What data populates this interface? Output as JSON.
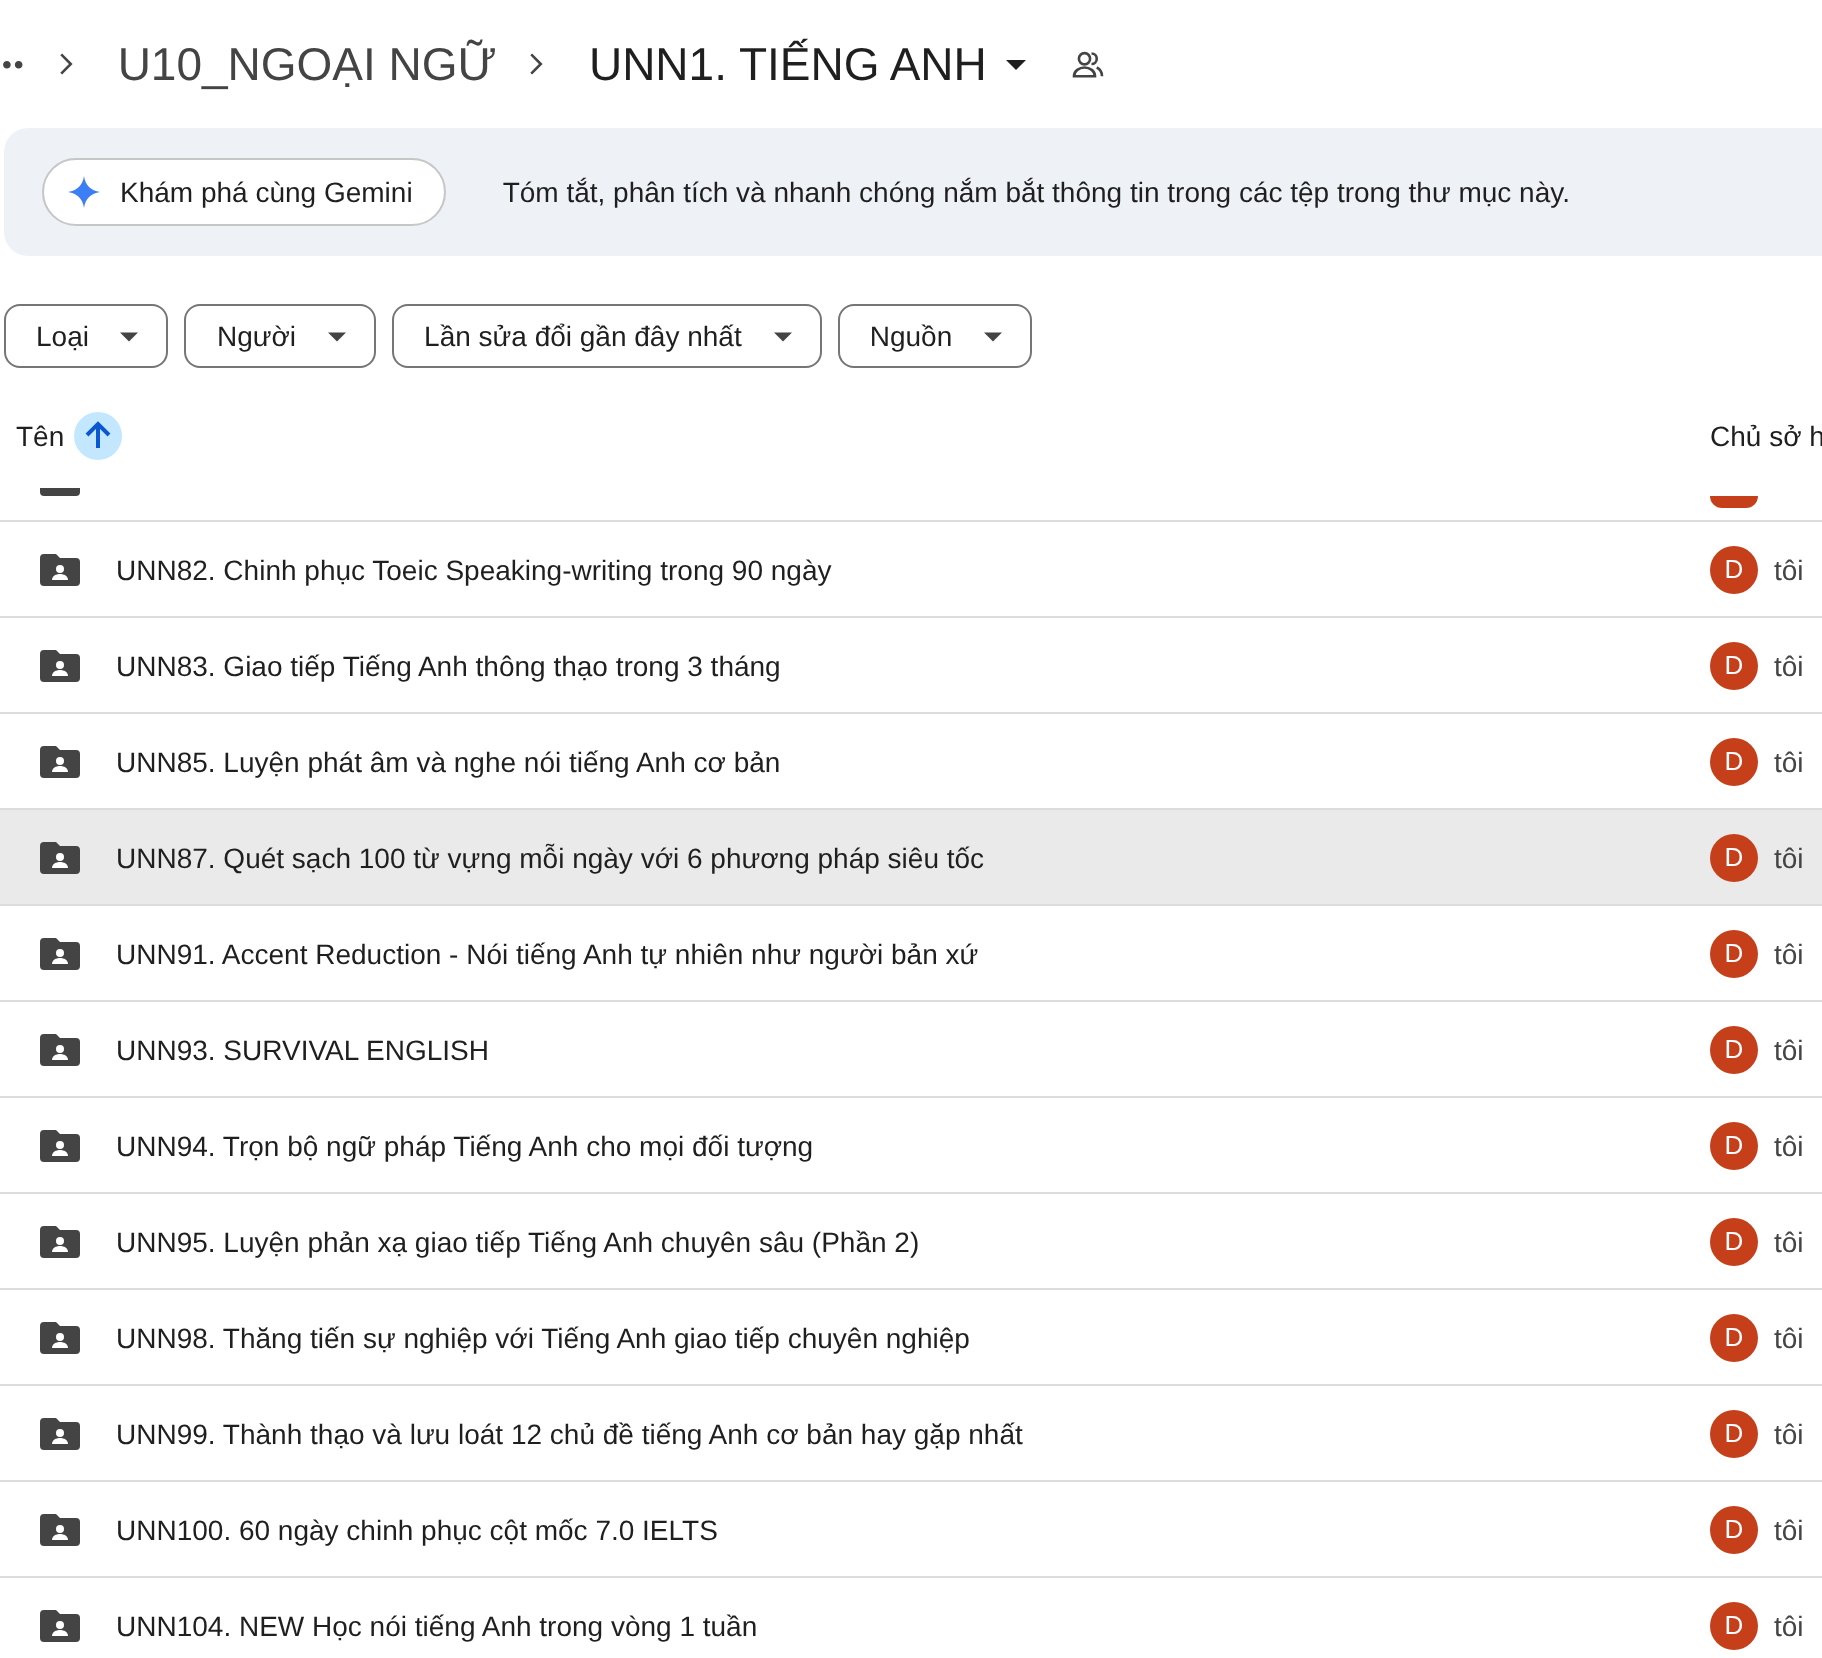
{
  "breadcrumb": {
    "more": "••",
    "parent": "U10_NGOẠI NGỮ",
    "current": "UNN1. TIẾNG ANH"
  },
  "gemini": {
    "button": "Khám phá cùng Gemini",
    "description": "Tóm tắt, phân tích và nhanh chóng nắm bắt thông tin trong các tệp trong thư mục này."
  },
  "filters": [
    "Loại",
    "Người",
    "Lần sửa đổi gần đây nhất",
    "Nguồn"
  ],
  "table": {
    "columns": [
      "Tên",
      "Chủ sở h"
    ],
    "rows": [
      {
        "name": "UNN82. Chinh phục Toeic Speaking-writing trong 90 ngày",
        "owner_initial": "D",
        "owner": "tôi",
        "selected": false
      },
      {
        "name": "UNN83. Giao tiếp Tiếng Anh thông thạo trong 3 tháng",
        "owner_initial": "D",
        "owner": "tôi",
        "selected": false
      },
      {
        "name": "UNN85. Luyện phát âm và nghe nói tiếng Anh cơ bản",
        "owner_initial": "D",
        "owner": "tôi",
        "selected": false
      },
      {
        "name": "UNN87. Quét sạch 100 từ vựng mỗi ngày với 6 phương pháp siêu tốc",
        "owner_initial": "D",
        "owner": "tôi",
        "selected": true
      },
      {
        "name": "UNN91. Accent Reduction - Nói tiếng Anh tự nhiên như người bản xứ",
        "owner_initial": "D",
        "owner": "tôi",
        "selected": false
      },
      {
        "name": "UNN93. SURVIVAL ENGLISH",
        "owner_initial": "D",
        "owner": "tôi",
        "selected": false
      },
      {
        "name": "UNN94. Trọn bộ ngữ pháp Tiếng Anh cho mọi đối tượng",
        "owner_initial": "D",
        "owner": "tôi",
        "selected": false
      },
      {
        "name": "UNN95. Luyện phản xạ giao tiếp Tiếng Anh chuyên sâu (Phần 2)",
        "owner_initial": "D",
        "owner": "tôi",
        "selected": false
      },
      {
        "name": "UNN98. Thăng tiến sự nghiệp với Tiếng Anh giao tiếp chuyên nghiệp",
        "owner_initial": "D",
        "owner": "tôi",
        "selected": false
      },
      {
        "name": "UNN99. Thành thạo và lưu loát 12 chủ đề tiếng Anh cơ bản hay gặp nhất",
        "owner_initial": "D",
        "owner": "tôi",
        "selected": false
      },
      {
        "name": "UNN100. 60 ngày chinh phục cột mốc 7.0 IELTS",
        "owner_initial": "D",
        "owner": "tôi",
        "selected": false
      },
      {
        "name": "UNN104. NEW Học nói tiếng Anh trong vòng 1 tuần",
        "owner_initial": "D",
        "owner": "tôi",
        "selected": false
      }
    ]
  }
}
